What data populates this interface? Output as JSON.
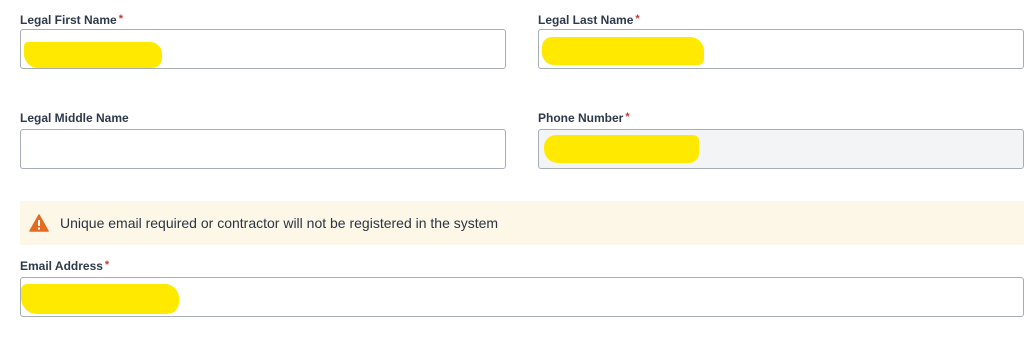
{
  "fields": {
    "first_name": {
      "label": "Legal First Name",
      "required_marker": "*",
      "value": ""
    },
    "last_name": {
      "label": "Legal Last Name",
      "required_marker": "*",
      "value": ""
    },
    "middle_name": {
      "label": "Legal Middle Name",
      "value": ""
    },
    "phone": {
      "label": "Phone Number",
      "required_marker": "*",
      "value": ""
    },
    "email": {
      "label": "Email Address",
      "required_marker": "*",
      "value": ""
    }
  },
  "alert": {
    "icon": "warning-icon",
    "text": "Unique email required or contractor will not be registered in the system"
  },
  "colors": {
    "required": "#c23934",
    "warning_icon": "#e56b1f",
    "alert_background": "#fdf7e7",
    "redaction": "#ffe900",
    "readonly_background": "#f3f4f6"
  }
}
